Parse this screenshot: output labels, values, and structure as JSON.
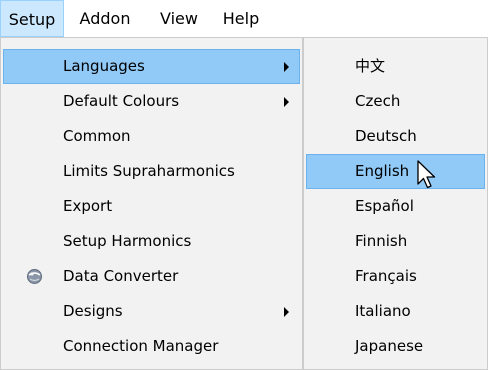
{
  "menubar": {
    "items": [
      {
        "label": "Setup",
        "active": true
      },
      {
        "label": "Addon",
        "active": false
      },
      {
        "label": "View",
        "active": false
      },
      {
        "label": "Help",
        "active": false
      }
    ]
  },
  "setup_menu": {
    "items": [
      {
        "label": "Languages",
        "has_submenu": true,
        "highlighted": true
      },
      {
        "label": "Default Colours",
        "has_submenu": true
      },
      {
        "label": "Common"
      },
      {
        "label": "Limits Supraharmonics"
      },
      {
        "label": "Export"
      },
      {
        "label": "Setup Harmonics"
      },
      {
        "label": "Data Converter",
        "icon": "data-converter-icon"
      },
      {
        "label": "Designs",
        "has_submenu": true
      },
      {
        "label": "Connection Manager"
      }
    ]
  },
  "languages_submenu": {
    "items": [
      {
        "label": "中文"
      },
      {
        "label": "Czech"
      },
      {
        "label": "Deutsch"
      },
      {
        "label": "English",
        "highlighted": true
      },
      {
        "label": "Español"
      },
      {
        "label": "Finnish"
      },
      {
        "label": "Français"
      },
      {
        "label": "Italiano"
      },
      {
        "label": "Japanese"
      }
    ]
  },
  "colors": {
    "menu_highlight": "#91c9f7",
    "menubar_active": "#cce8ff",
    "menu_background": "#f2f2f2"
  }
}
